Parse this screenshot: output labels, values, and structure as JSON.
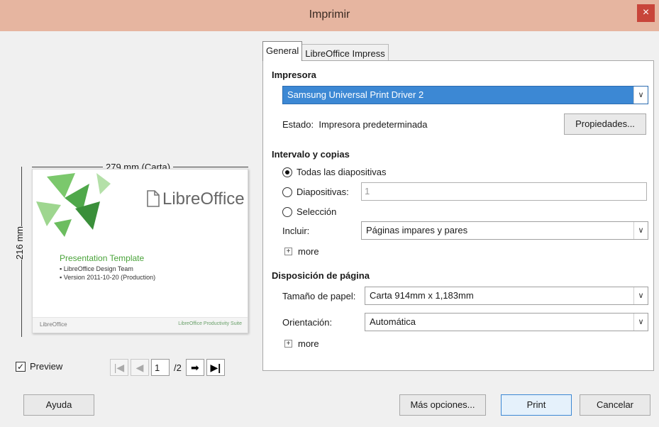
{
  "window": {
    "title": "Imprimir",
    "close_glyph": "×"
  },
  "preview": {
    "width_label": "279 mm (Carta)",
    "height_label": "216 mm",
    "slide": {
      "brand_prefix": "",
      "brand": "LibreOffice",
      "title": "Presentation Template",
      "bullet1": "LibreOffice Design Team",
      "bullet2": "Version 2011-10-20 (Production)",
      "footer_left": "LibreOffice",
      "footer_right": "LibreOffice Productivity Suite"
    },
    "preview_label": "Preview",
    "preview_checked": true,
    "page_current": "1",
    "page_total": "/2"
  },
  "tabs": [
    "General",
    "LibreOffice Impress"
  ],
  "printer": {
    "section": "Impresora",
    "selected": "Samsung Universal Print Driver 2",
    "status_label": "Estado:",
    "status_value": "Impresora predeterminada",
    "properties_button": "Propiedades..."
  },
  "range": {
    "section": "Intervalo y copias",
    "all_slides": "Todas las diapositivas",
    "slides": "Diapositivas:",
    "slides_value": "1",
    "selection": "Selección",
    "include_label": "Incluir:",
    "include_value": "Páginas impares y pares",
    "more": "more"
  },
  "layout": {
    "section": "Disposición de página",
    "paper_label": "Tamaño de papel:",
    "paper_value": "Carta 914mm x 1,183mm",
    "orientation_label": "Orientación:",
    "orientation_value": "Automática",
    "more": "more"
  },
  "buttons": {
    "help": "Ayuda",
    "more_options": "Más opciones...",
    "print": "Print",
    "cancel": "Cancelar"
  }
}
